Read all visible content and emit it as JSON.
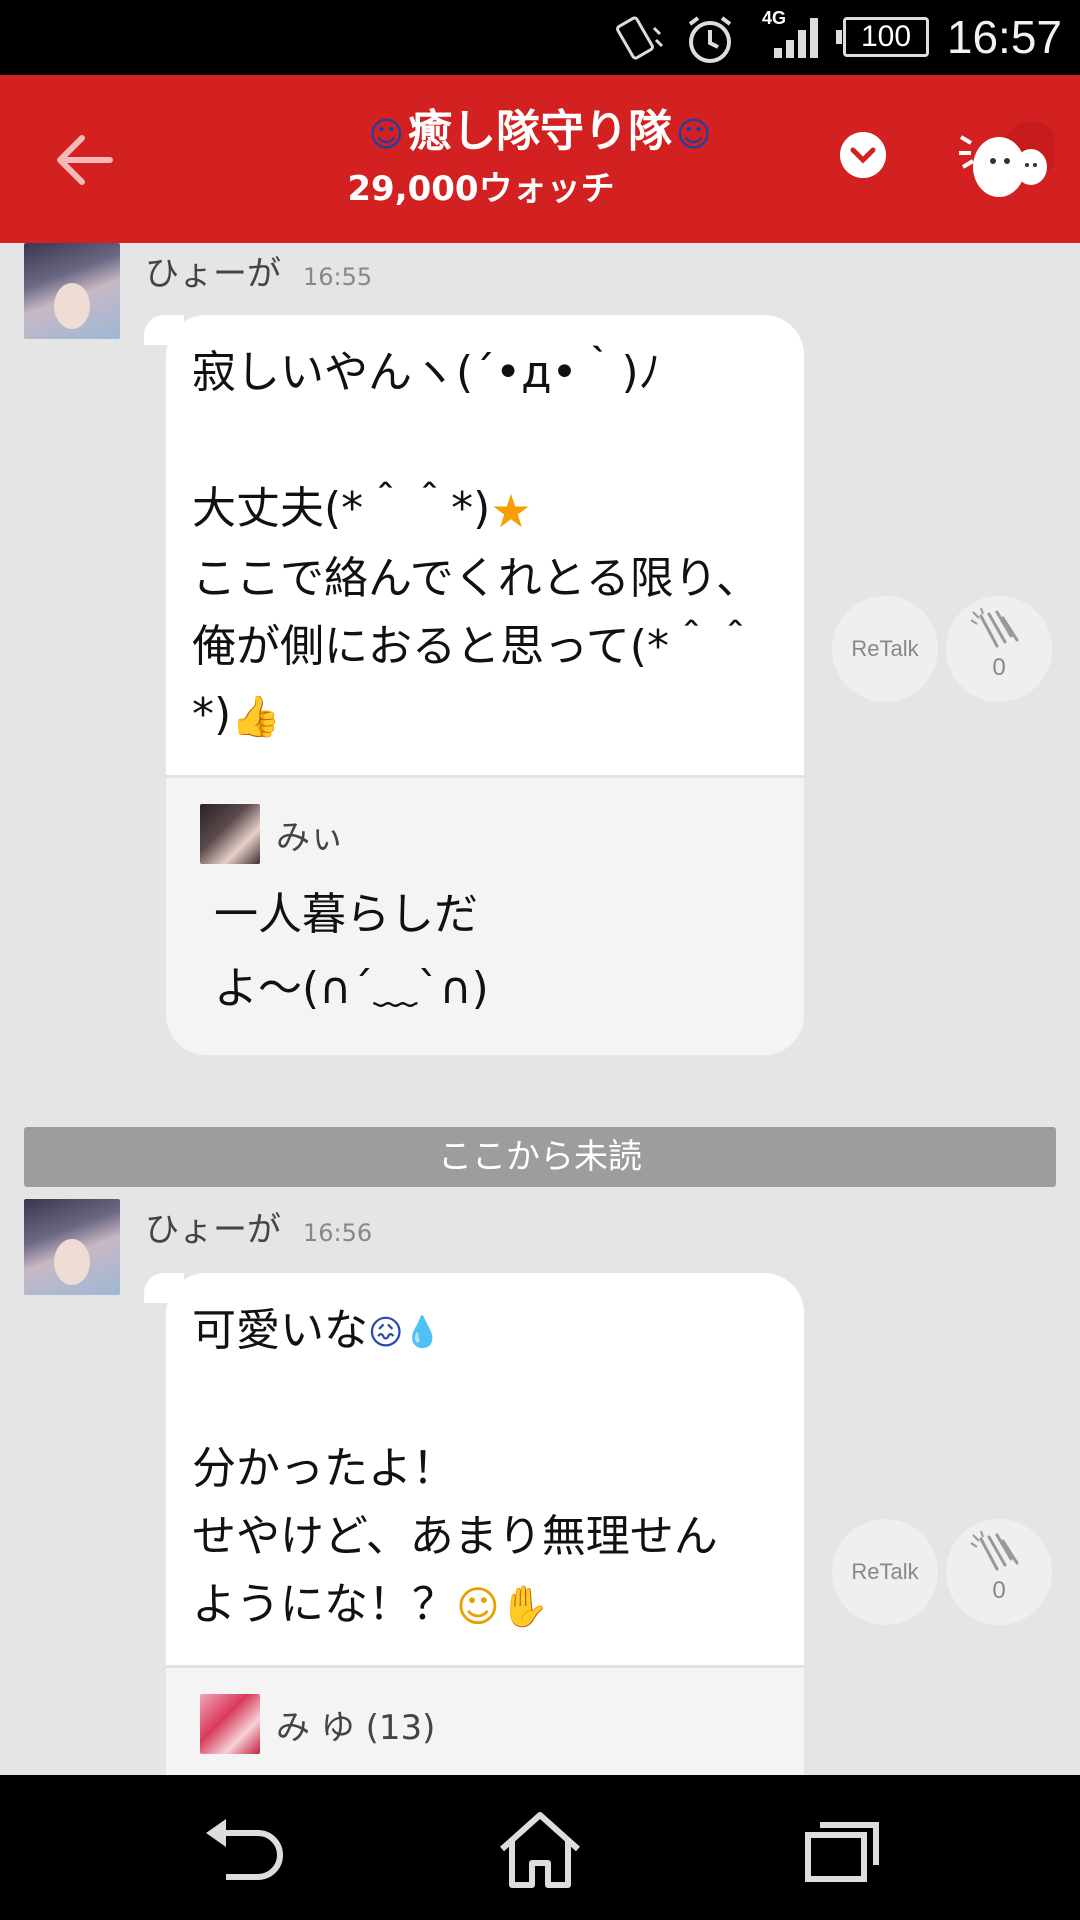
{
  "status_bar": {
    "network": "4G",
    "battery": "100",
    "time": "16:57"
  },
  "header": {
    "title": "癒し隊守り隊",
    "subtitle": "29,000ウォッチ"
  },
  "messages": [
    {
      "sender": "ひょーが",
      "time": "16:55",
      "text_parts": [
        "寂しいやんヽ(´•д•｀)ﾉ\n\n大丈夫(*＾＾*)",
        "ここで絡んでくれとる限り、俺が側におると思って(*＾＾*)"
      ],
      "quote": {
        "name": "みぃ",
        "text": "一人暮らしだ\nよ〜(∩´﹏`∩)"
      },
      "retalk_label": "ReTalk",
      "clap_count": "0"
    },
    {
      "sender": "ひょーが",
      "time": "16:56",
      "text_parts": [
        "可愛いな",
        "分かったよ！\nせやけど、あまり無理せん\nようにな！？"
      ],
      "quote": {
        "name": "み ゆ (13)"
      },
      "retalk_label": "ReTalk",
      "clap_count": "0"
    }
  ],
  "unread_divider": "ここから未読",
  "colors": {
    "header_bg": "#d32020",
    "divider_bg": "#9d9d9d",
    "bubble_bg": "#ffffff"
  }
}
